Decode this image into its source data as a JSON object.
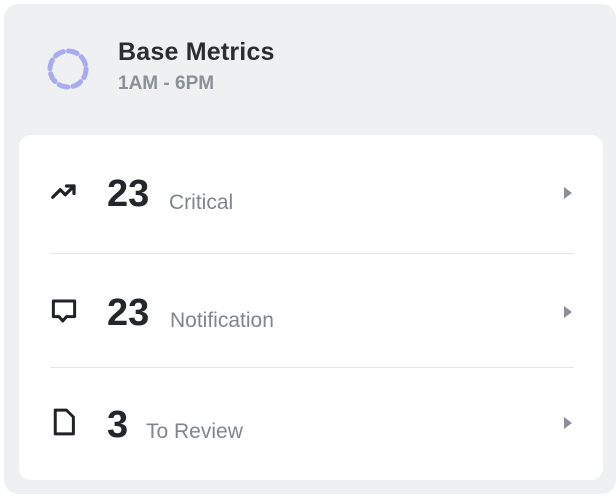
{
  "header": {
    "title": "Base Metrics",
    "subtitle": "1AM - 6PM",
    "icon": "dashed-circle-icon",
    "icon_color": "#a9abf2"
  },
  "metrics": [
    {
      "value": "23",
      "label": "Critical",
      "icon": "trending-up-icon"
    },
    {
      "value": "23",
      "label": "Notification",
      "icon": "message-square-icon"
    },
    {
      "value": "3",
      "label": "To Review",
      "icon": "document-icon"
    }
  ],
  "colors": {
    "panel_bg": "#eef0f2",
    "card_bg": "#ffffff",
    "chevron": "#8b9096"
  }
}
